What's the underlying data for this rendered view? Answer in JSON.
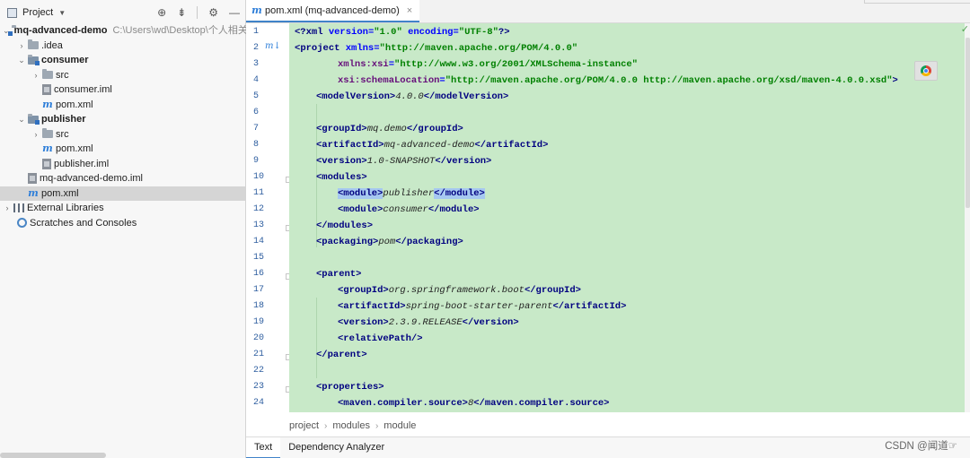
{
  "project_panel": {
    "title": "Project",
    "tree": [
      {
        "label": "mq-advanced-demo",
        "path": "C:\\Users\\wd\\Desktop\\个人相关\\",
        "icon": "module-folder-icon"
      },
      {
        "label": ".idea",
        "icon": "folder-icon"
      },
      {
        "label": "consumer",
        "icon": "module-folder-icon"
      },
      {
        "label": "src",
        "icon": "folder-icon"
      },
      {
        "label": "consumer.iml",
        "icon": "iml-file-icon"
      },
      {
        "label": "pom.xml",
        "icon": "maven-icon"
      },
      {
        "label": "publisher",
        "icon": "module-folder-icon"
      },
      {
        "label": "src",
        "icon": "folder-icon"
      },
      {
        "label": "pom.xml",
        "icon": "maven-icon"
      },
      {
        "label": "publisher.iml",
        "icon": "iml-file-icon"
      },
      {
        "label": "mq-advanced-demo.iml",
        "icon": "iml-file-icon"
      },
      {
        "label": "pom.xml",
        "icon": "maven-icon"
      },
      {
        "label": "External Libraries",
        "icon": "library-icon"
      },
      {
        "label": "Scratches and Consoles",
        "icon": "scratch-icon"
      }
    ]
  },
  "editor": {
    "tab_label": "pom.xml (mq-advanced-demo)",
    "tab_close": "×",
    "check_mark": "✓",
    "line_numbers": [
      "1",
      "2",
      "3",
      "4",
      "5",
      "6",
      "7",
      "8",
      "9",
      "10",
      "11",
      "12",
      "13",
      "14",
      "15",
      "16",
      "17",
      "18",
      "19",
      "20",
      "21",
      "22",
      "23",
      "24"
    ],
    "gutter_marker": "m↓",
    "code": {
      "l1": {
        "open": "<?",
        "tag": "xml",
        "a1": " version",
        "eq1": "=",
        "v1": "\"1.0\"",
        "a2": " encoding",
        "eq2": "=",
        "v2": "\"UTF-8\"",
        "close": "?>"
      },
      "l2": {
        "open": "<",
        "tag": "project",
        "a1": " xmlns",
        "eq1": "=",
        "v1": "\"http://maven.apache.org/POM/4.0.0\""
      },
      "l3": {
        "ns": "xmlns:xsi",
        "eq": "=",
        "v": "\"http://www.w3.org/2001/XMLSchema-instance\""
      },
      "l4": {
        "ns": "xsi:schemaLocation",
        "eq": "=",
        "v": "\"http://maven.apache.org/POM/4.0.0 http://maven.apache.org/xsd/maven-4.0.0.xsd\"",
        "close": ">"
      },
      "l5": {
        "o": "<modelVersion>",
        "val": "4.0.0",
        "c": "</modelVersion>"
      },
      "l7": {
        "o": "<groupId>",
        "val": "mq.demo",
        "c": "</groupId>"
      },
      "l8": {
        "o": "<artifactId>",
        "val": "mq-advanced-demo",
        "c": "</artifactId>"
      },
      "l9": {
        "o": "<version>",
        "val": "1.0-SNAPSHOT",
        "c": "</version>"
      },
      "l10": {
        "o": "<modules>"
      },
      "l11": {
        "o": "<module>",
        "val": "publisher",
        "c": "</module>"
      },
      "l12": {
        "o": "<module>",
        "val": "consumer",
        "c": "</module>"
      },
      "l13": {
        "c": "</modules>"
      },
      "l14": {
        "o": "<packaging>",
        "val": "pom",
        "c": "</packaging>"
      },
      "l16": {
        "o": "<parent>"
      },
      "l17": {
        "o": "<groupId>",
        "val": "org.springframework.boot",
        "c": "</groupId>"
      },
      "l18": {
        "o": "<artifactId>",
        "val": "spring-boot-starter-parent",
        "c": "</artifactId>"
      },
      "l19": {
        "o": "<version>",
        "val": "2.3.9.RELEASE",
        "c": "</version>"
      },
      "l20": {
        "o": "<relativePath/>"
      },
      "l21": {
        "c": "</parent>"
      },
      "l23": {
        "o": "<properties>"
      },
      "l24": {
        "o": "<maven.compiler.source>",
        "val": "8",
        "c": "</maven.compiler.source>"
      }
    },
    "breadcrumb": [
      "project",
      "modules",
      "module"
    ],
    "breadcrumb_sep": "›",
    "bottom_tabs": [
      "Text",
      "Dependency Analyzer"
    ]
  },
  "watermark": "CSDN @闻道☞"
}
